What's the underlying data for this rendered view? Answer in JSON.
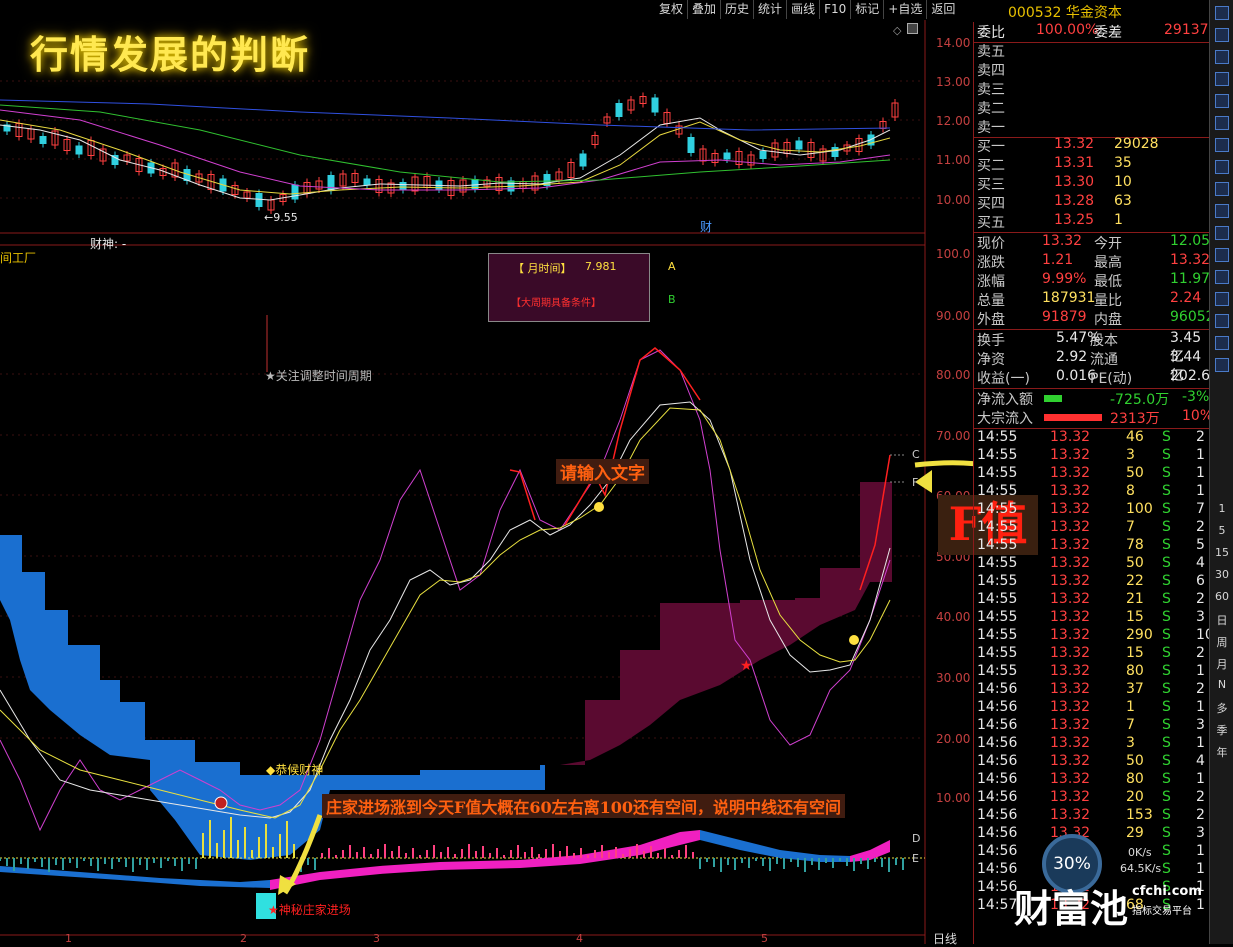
{
  "toolbar": {
    "items": [
      "复权",
      "叠加",
      "历史",
      "统计",
      "画线",
      "F10",
      "标记",
      "+自选",
      "返回"
    ]
  },
  "chart": {
    "banner": "行情发展的判断",
    "price_axis": [
      "14.00",
      "13.00",
      "12.00",
      "11.00",
      "10.00"
    ],
    "osc_axis": [
      "100.0",
      "90.00",
      "80.00",
      "70.00",
      "60.00",
      "50.00",
      "40.00",
      "30.00",
      "20.00",
      "10.00"
    ],
    "low_label": "←9.55",
    "cai_label": "财",
    "caishen_label": "财神: -",
    "left_cut": "间工厂",
    "month_time_label": "【 月时间】",
    "month_time_value": "7.981",
    "cond_label": "【大周期具备条件】",
    "tag_a": "A",
    "tag_b": "B",
    "focus_label": "★关注调整时间周期",
    "input_prompt": "请输入文字",
    "f_value": "F值",
    "gong_label": "◆恭候财神",
    "long_note": "庄家进场涨到今天F值大概在60左右离100还有空间，说明中线还有空间",
    "mystery_label": "神秘庄家进场",
    "line_c": "C",
    "line_f": "F",
    "line_d": "D",
    "line_e": "E",
    "x_ticks": [
      "1",
      "2",
      "3",
      "4",
      "5"
    ],
    "period": "日线"
  },
  "quote": {
    "code": "000532",
    "name": "华金资本",
    "weibi_label": "委比",
    "weibi": "100.00%",
    "weicha_label": "委差",
    "weicha": "29137",
    "sells": [
      "卖五",
      "卖四",
      "卖三",
      "卖二",
      "卖一"
    ],
    "buys": [
      {
        "label": "买一",
        "price": "13.32",
        "vol": "29028"
      },
      {
        "label": "买二",
        "price": "13.31",
        "vol": "35"
      },
      {
        "label": "买三",
        "price": "13.30",
        "vol": "10"
      },
      {
        "label": "买四",
        "price": "13.28",
        "vol": "63"
      },
      {
        "label": "买五",
        "price": "13.25",
        "vol": "1"
      }
    ],
    "stats": [
      {
        "l1": "现价",
        "v1": "13.32",
        "l2": "今开",
        "v2": "12.05"
      },
      {
        "l1": "涨跌",
        "v1": "1.21",
        "l2": "最高",
        "v2": "13.32"
      },
      {
        "l1": "涨幅",
        "v1": "9.99%",
        "l2": "最低",
        "v2": "11.97"
      },
      {
        "l1": "总量",
        "v1": "187931",
        "l2": "量比",
        "v2": "2.24"
      },
      {
        "l1": "外盘",
        "v1": "91879",
        "l2": "内盘",
        "v2": "96052"
      }
    ],
    "stats2": [
      {
        "l1": "换手",
        "v1": "5.47%",
        "l2": "股本",
        "v2": "3.45亿"
      },
      {
        "l1": "净资",
        "v1": "2.92",
        "l2": "流通",
        "v2": "3.44亿"
      },
      {
        "l1": "收益(一)",
        "v1": "0.016",
        "l2": "PE(动)",
        "v2": "202.6"
      }
    ],
    "flow": [
      {
        "label": "净流入额",
        "val": "-725.0万",
        "pct": "-3%"
      },
      {
        "label": "大宗流入",
        "val": "2313万",
        "pct": "10%"
      }
    ],
    "ticks": [
      [
        "14:55",
        "13.32",
        "46",
        "S",
        "2"
      ],
      [
        "14:55",
        "13.32",
        "3",
        "S",
        "1"
      ],
      [
        "14:55",
        "13.32",
        "50",
        "S",
        "1"
      ],
      [
        "14:55",
        "13.32",
        "8",
        "S",
        "1"
      ],
      [
        "14:55",
        "13.32",
        "100",
        "S",
        "7"
      ],
      [
        "14:55",
        "13.32",
        "7",
        "S",
        "2"
      ],
      [
        "14:55",
        "13.32",
        "78",
        "S",
        "5"
      ],
      [
        "14:55",
        "13.32",
        "50",
        "S",
        "4"
      ],
      [
        "14:55",
        "13.32",
        "22",
        "S",
        "6"
      ],
      [
        "14:55",
        "13.32",
        "21",
        "S",
        "2"
      ],
      [
        "14:55",
        "13.32",
        "15",
        "S",
        "3"
      ],
      [
        "14:55",
        "13.32",
        "290",
        "S",
        "10"
      ],
      [
        "14:55",
        "13.32",
        "15",
        "S",
        "2"
      ],
      [
        "14:55",
        "13.32",
        "80",
        "S",
        "1"
      ],
      [
        "14:56",
        "13.32",
        "37",
        "S",
        "2"
      ],
      [
        "14:56",
        "13.32",
        "1",
        "S",
        "1"
      ],
      [
        "14:56",
        "13.32",
        "7",
        "S",
        "3"
      ],
      [
        "14:56",
        "13.32",
        "3",
        "S",
        "1"
      ],
      [
        "14:56",
        "13.32",
        "50",
        "S",
        "4"
      ],
      [
        "14:56",
        "13.32",
        "80",
        "S",
        "1"
      ],
      [
        "14:56",
        "13.32",
        "20",
        "S",
        "2"
      ],
      [
        "14:56",
        "13.32",
        "153",
        "S",
        "2"
      ],
      [
        "14:56",
        "13.32",
        "29",
        "S",
        "3"
      ],
      [
        "14:56",
        "13.32",
        "",
        "S",
        "1"
      ],
      [
        "14:56",
        "13.32",
        "",
        "S",
        "1"
      ],
      [
        "14:56",
        "13.32",
        "",
        "S",
        "1"
      ],
      [
        "14:57",
        "13.32",
        "68",
        "S",
        "1"
      ]
    ]
  },
  "vtools": [
    "1",
    "5",
    "15",
    "30",
    "60",
    "日",
    "周",
    "月",
    "N",
    "多",
    "季",
    "年"
  ],
  "overlay": {
    "pct": "30%",
    "up": "0K/s",
    "down": "64.5K/s",
    "brand": "财富池",
    "site": "cfchi.com",
    "site_sub": "指标交易平台"
  }
}
